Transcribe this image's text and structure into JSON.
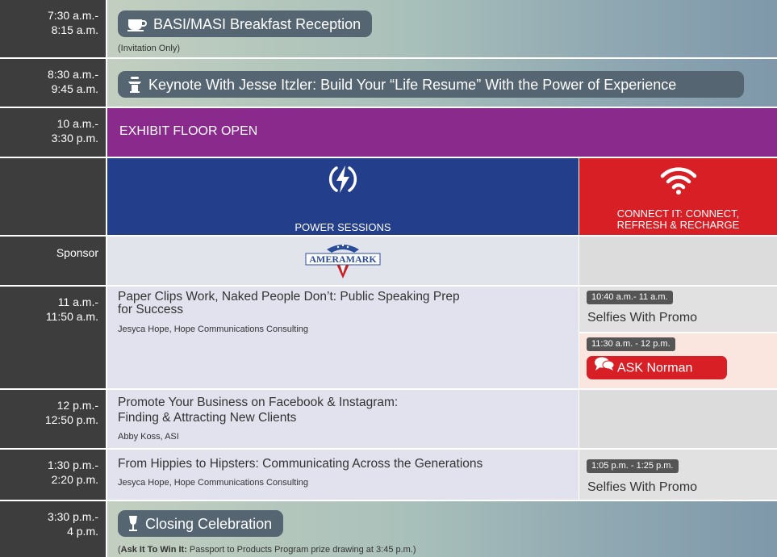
{
  "rows": [
    {
      "time": [
        "7:30 a.m.-",
        "8:15 a.m."
      ],
      "event": "BASI/MASI Breakfast Reception",
      "icon": "coffee-cup-icon",
      "note": "(Invitation Only)"
    },
    {
      "time": [
        "8:30 a.m.-",
        "9:45 a.m."
      ],
      "event": "Keynote With Jesse Itzler: Build Your “Life Resume” With the Power of Experience",
      "icon": "podium-icon"
    },
    {
      "time": [
        "10 a.m.-",
        "3:30 p.m."
      ],
      "event": "EXHIBIT FLOOR OPEN"
    },
    {
      "time": [
        "3:30 p.m.-",
        "4 p.m."
      ],
      "event": "Closing Celebration",
      "icon": "wine-glass-icon",
      "note_bold": "Ask It To Win It:",
      "note_rest": " Passport to Products Program prize drawing at 3:45 p.m.)",
      "note_open": "("
    }
  ],
  "tracks": {
    "power": {
      "label": "POWER SESSIONS",
      "icon": "lightning-bolt-icon",
      "color": "#233e8b"
    },
    "connect": {
      "label_line1": "CONNECT IT: CONNECT,",
      "label_line2": "REFRESH & RECHARGE",
      "icon": "wifi-icon",
      "color": "#d81f25"
    }
  },
  "sponsor": {
    "label": "Sponsor",
    "logo_text": "AMERAMARK"
  },
  "sessions": [
    {
      "time": [
        "11 a.m.-",
        "11:50 a.m."
      ],
      "title_line1": "Paper Clips Work, Naked People Don’t: Public Speaking Prep",
      "title_line2": "for Success",
      "speaker": "Jesyca Hope, Hope Communications Consulting"
    },
    {
      "time": [
        "12 p.m.-",
        "12:50 p.m."
      ],
      "title_line1": "Promote Your Business on Facebook & Instagram:",
      "title_line2": "Finding & Attracting New Clients",
      "speaker": "Abby Koss, ASI"
    },
    {
      "time": [
        "1:30 p.m.-",
        "2:20 p.m."
      ],
      "title_line1": "From Hippies to Hipsters: Communicating Across the Generations",
      "speaker": "Jesyca Hope, Hope Communications Consulting"
    }
  ],
  "connect_items": [
    {
      "time": "10:40 a.m.- 11 a.m.",
      "label": "Selfies With Promo"
    },
    {
      "time": "11:30 a.m. - 12 p.m.",
      "label": "ASK Norman",
      "icon": "chat-bubbles-icon",
      "color": "#d81f25"
    },
    {
      "time": "1:05 p.m. - 1:25 p.m.",
      "label": "Selfies With Promo"
    }
  ]
}
